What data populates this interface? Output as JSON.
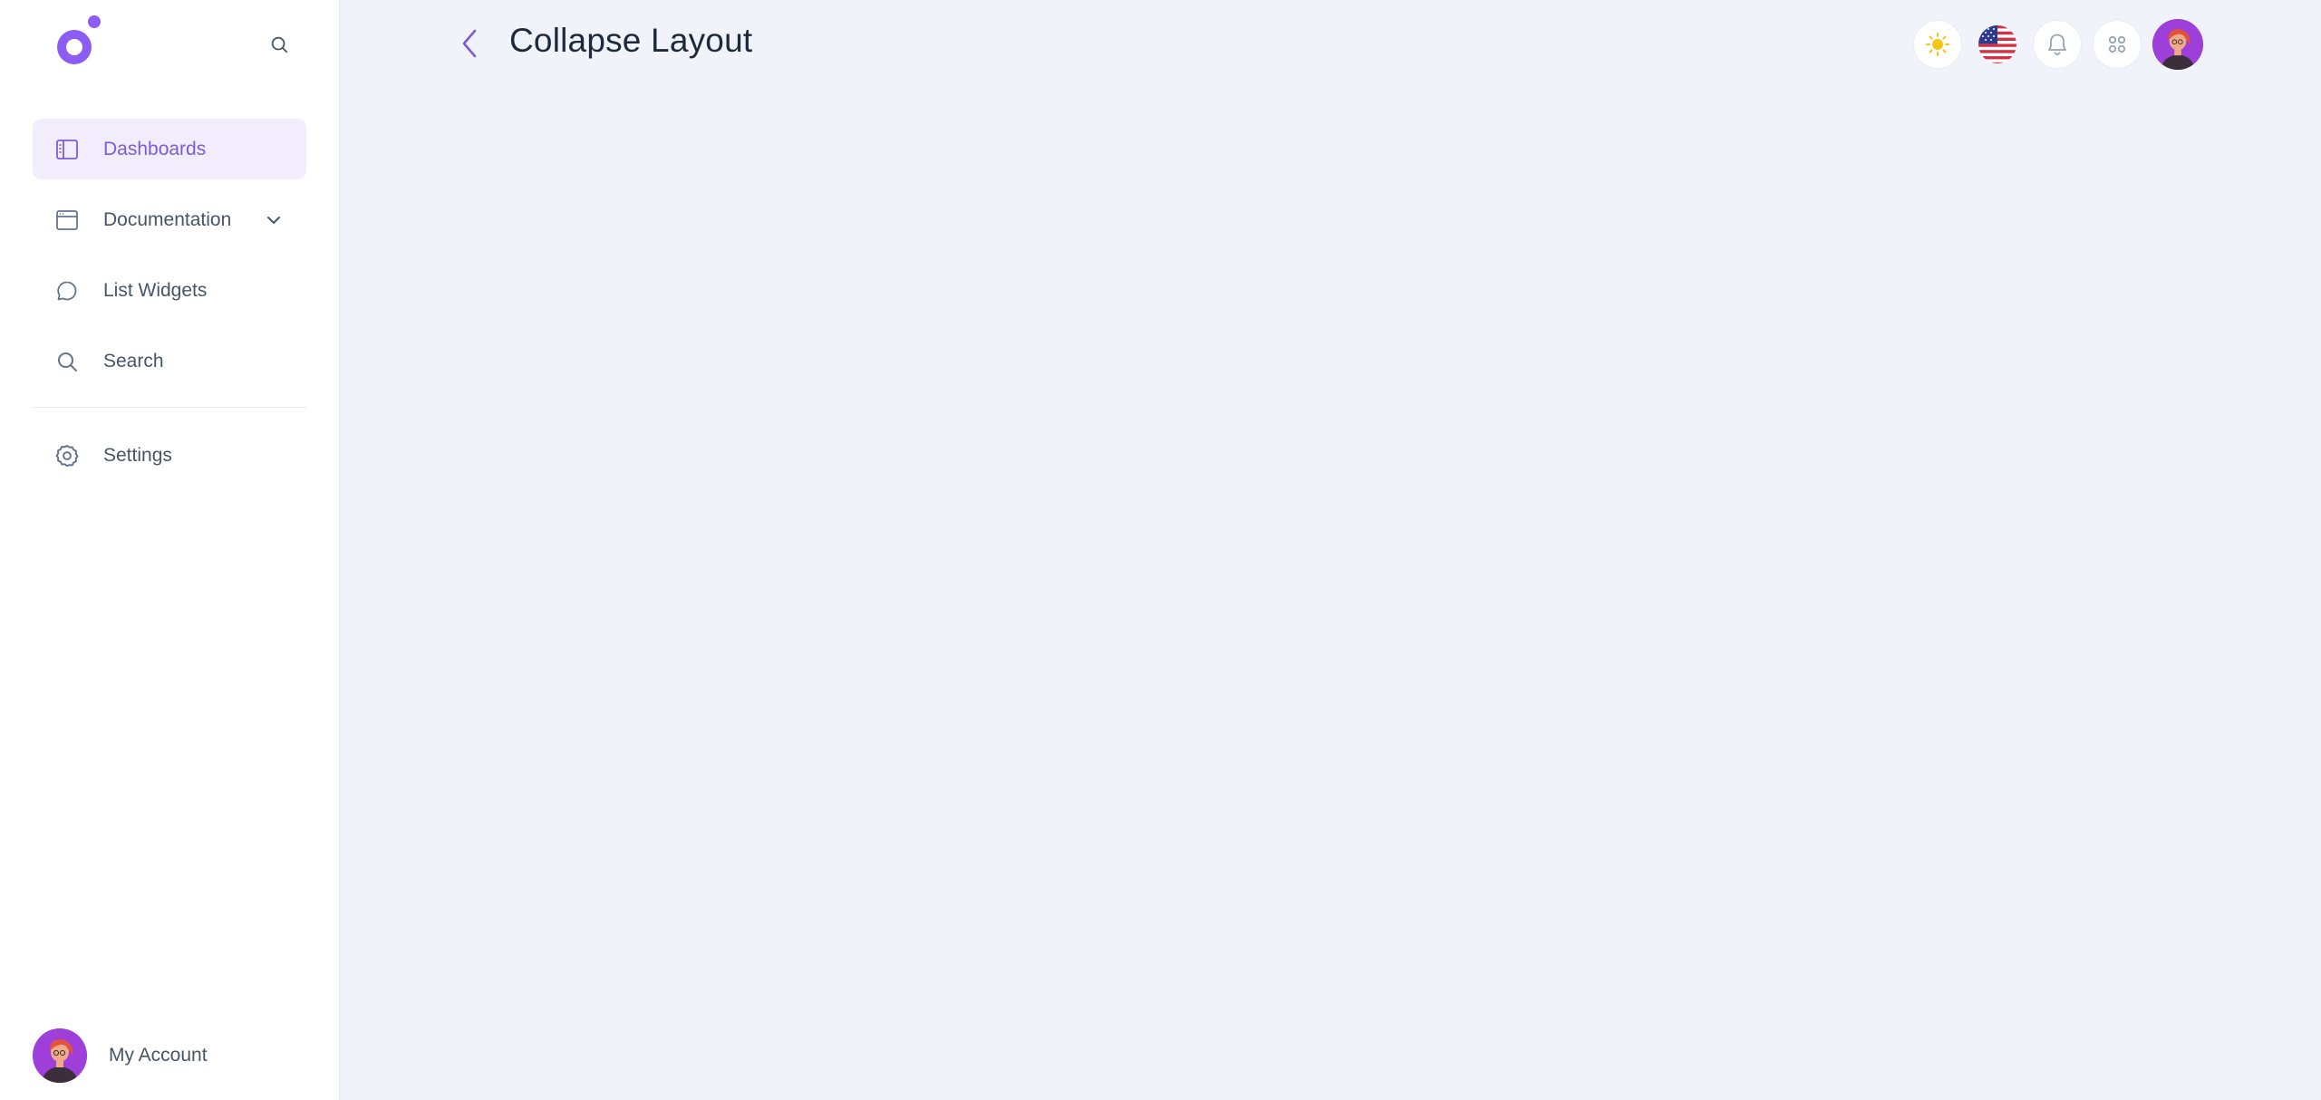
{
  "header": {
    "title": "Collapse Layout"
  },
  "sidebar": {
    "items": [
      {
        "label": "Dashboards"
      },
      {
        "label": "Documentation"
      },
      {
        "label": "List Widgets"
      },
      {
        "label": "Search"
      },
      {
        "label": "Settings"
      }
    ],
    "account_label": "My Account"
  },
  "icons": {
    "logo": "brand-logo",
    "sidebar_search": "search-icon",
    "dashboards": "sidebar-layout-icon",
    "documentation": "browser-window-icon",
    "documentation_expand": "chevron-down-icon",
    "list_widgets": "chat-bubble-icon",
    "search": "search-icon",
    "settings": "gear-icon",
    "back": "chevron-left-icon",
    "theme": "sun-icon",
    "language": "us-flag-icon",
    "notifications": "bell-icon",
    "apps": "grid-icon"
  },
  "colors": {
    "accent": "#7c5cd6",
    "active_bg": "#f1edfd",
    "page_bg": "#f0f3f9",
    "sun": "#f5c518"
  }
}
